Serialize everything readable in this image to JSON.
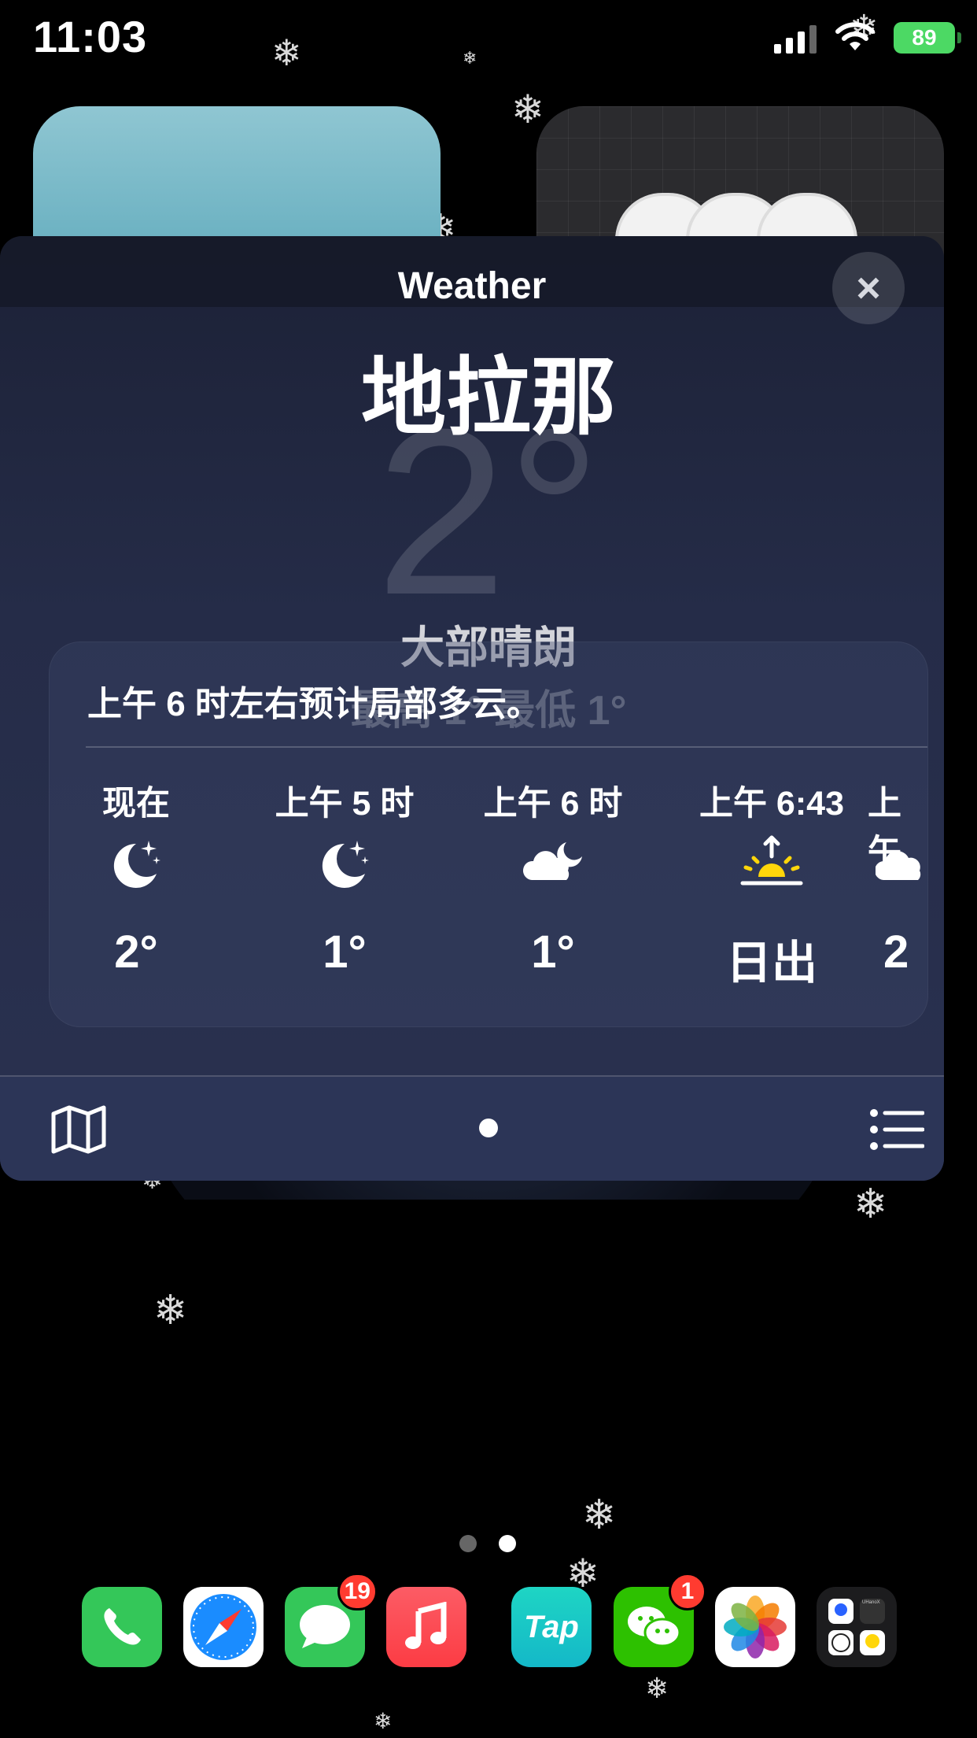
{
  "status_bar": {
    "time": "11:03",
    "battery": "89"
  },
  "weather_sheet": {
    "title": "Weather",
    "close_icon": "×",
    "city": "地拉那",
    "current_temp": "2°",
    "condition": "大部晴朗",
    "high_low": "最高 1° 最低 1°",
    "summary": "上午 6 时左右预计局部多云。",
    "hourly": [
      {
        "label": "现在",
        "icon": "moon-stars-icon",
        "temp": "2°"
      },
      {
        "label": "上午 5 时",
        "icon": "moon-stars-icon",
        "temp": "1°"
      },
      {
        "label": "上午 6 时",
        "icon": "cloud-moon-icon",
        "temp": "1°"
      },
      {
        "label": "上午 6:43",
        "icon": "sunrise-icon",
        "temp": "日出"
      },
      {
        "label": "上午",
        "icon": "cloud-icon",
        "temp": "2"
      }
    ]
  },
  "dock": {
    "apps": [
      {
        "name": "Phone",
        "icon": "phone-icon",
        "color": "#34c759"
      },
      {
        "name": "Safari",
        "icon": "compass-icon",
        "color": "#ffffff"
      },
      {
        "name": "Messages",
        "icon": "message-bubble-icon",
        "color": "#34c759",
        "badge": "19"
      },
      {
        "name": "Music",
        "icon": "music-note-icon",
        "color": "#fc3c44"
      },
      {
        "name": "TapTap",
        "icon": "taptap-icon",
        "color": "#14c2c8",
        "text": "Tap"
      },
      {
        "name": "WeChat",
        "icon": "wechat-icon",
        "color": "#2dc100",
        "badge": "1"
      },
      {
        "name": "Photos",
        "icon": "photos-flower-icon",
        "color": "#ffffff"
      },
      {
        "name": "Folder",
        "icon": "app-folder-icon",
        "color": "#1c1c1e",
        "mini_label": "UHanoX"
      }
    ]
  },
  "colors": {
    "accent_yellow": "#ffd60a",
    "sheet_bg": "#252c48"
  }
}
